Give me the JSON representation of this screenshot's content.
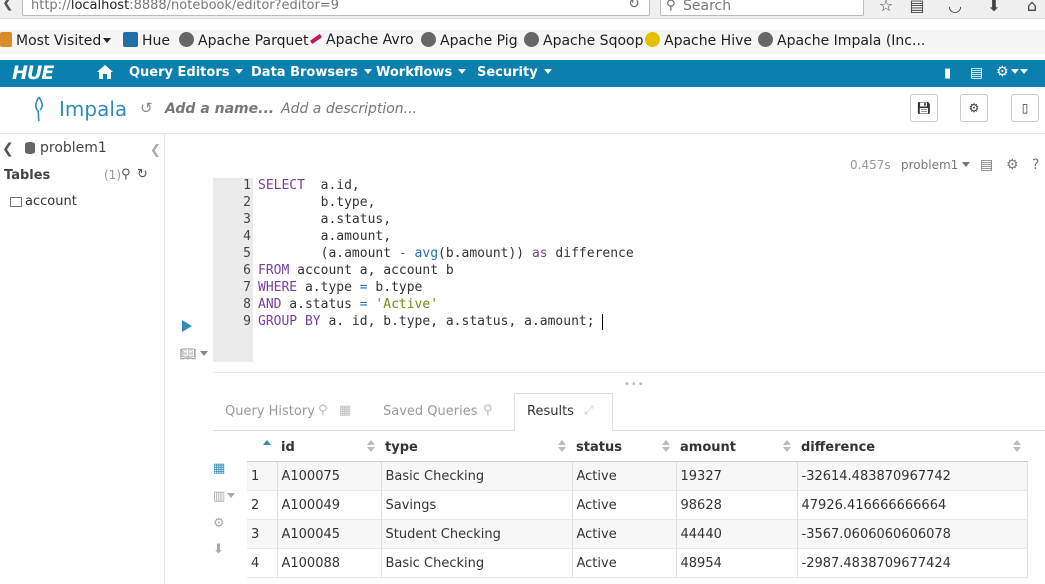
{
  "browser": {
    "url_prefix": "http://",
    "url_host": "localhost",
    "url_rest": ":8888/notebook/editor?editor=9",
    "search_placeholder": "Search"
  },
  "bookmarks": [
    {
      "label": "Most Visited",
      "icon": "folder-icon"
    },
    {
      "label": "Hue",
      "icon": "hue-icon"
    },
    {
      "label": "Apache Parquet",
      "icon": "globe-icon"
    },
    {
      "label": "Apache Avro",
      "icon": "feather-icon"
    },
    {
      "label": "Apache Pig",
      "icon": "globe-icon"
    },
    {
      "label": "Apache Sqoop",
      "icon": "globe-icon"
    },
    {
      "label": "Apache Hive",
      "icon": "hive-icon"
    },
    {
      "label": "Apache Impala (Inc...",
      "icon": "globe-icon"
    }
  ],
  "nav": {
    "logo": "HUE",
    "items": [
      "Query Editors",
      "Data Browsers",
      "Workflows",
      "Security"
    ]
  },
  "header": {
    "title": "Impala",
    "name_placeholder": "Add a name...",
    "description_placeholder": "Add a description..."
  },
  "left": {
    "database": "problem1",
    "tables_label": "Tables",
    "tables_count": "(1)",
    "tables": [
      "account"
    ]
  },
  "snippet": {
    "execution_time": "0.457s",
    "database": "problem1"
  },
  "editor": {
    "lines": [
      {
        "n": "1",
        "code": "SELECT  a.id,"
      },
      {
        "n": "2",
        "code": "        b.type,"
      },
      {
        "n": "3",
        "code": "        a.status,"
      },
      {
        "n": "4",
        "code": "        a.amount,"
      },
      {
        "n": "5",
        "code": "        (a.amount - avg(b.amount)) as difference"
      },
      {
        "n": "6",
        "code": "FROM account a, account b"
      },
      {
        "n": "7",
        "code": "WHERE a.type = b.type"
      },
      {
        "n": "8",
        "code": "AND a.status = 'Active'"
      },
      {
        "n": "9",
        "code": "GROUP BY a. id, b.type, a.status, a.amount;"
      }
    ]
  },
  "tabs": {
    "query_history": "Query History",
    "saved_queries": "Saved Queries",
    "results": "Results"
  },
  "results": {
    "columns": [
      "id",
      "type",
      "status",
      "amount",
      "difference"
    ],
    "rows": [
      {
        "n": "1",
        "id": "A100075",
        "type": "Basic Checking",
        "status": "Active",
        "amount": "19327",
        "difference": "-32614.483870967742"
      },
      {
        "n": "2",
        "id": "A100049",
        "type": "Savings",
        "status": "Active",
        "amount": "98628",
        "difference": "47926.416666666664"
      },
      {
        "n": "3",
        "id": "A100045",
        "type": "Student Checking",
        "status": "Active",
        "amount": "44440",
        "difference": "-3567.0606060606078"
      },
      {
        "n": "4",
        "id": "A100088",
        "type": "Basic Checking",
        "status": "Active",
        "amount": "48954",
        "difference": "-2987.4838709677424"
      }
    ]
  },
  "colors": {
    "nav_bg": "#0b7fad",
    "accent": "#338bb8"
  }
}
